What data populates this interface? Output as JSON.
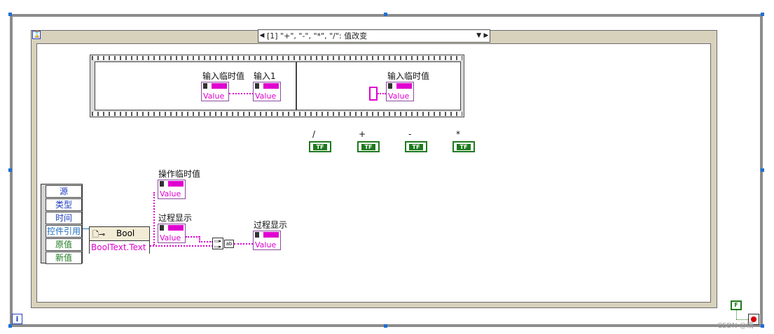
{
  "case_selector": {
    "label": "[1] \"+\", \"-\", \"*\", \"/\": 值改变"
  },
  "sequence": {
    "frame1": {
      "in_label": "输入临时值",
      "out_label": "输入1",
      "in_val": "Value",
      "out_val": "Value"
    },
    "frame2": {
      "label": "输入临时值",
      "val": "Value"
    }
  },
  "bool_labels": [
    "/",
    "+",
    "-",
    "*"
  ],
  "event_data": [
    "源",
    "类型",
    "时间",
    "控件引用",
    "原值",
    "新值"
  ],
  "ref_node": {
    "type": "Bool",
    "prop": "BoolText.Text"
  },
  "op_temp": {
    "label": "操作临时值",
    "val": "Value"
  },
  "process1": {
    "label": "过程显示",
    "val": "Value"
  },
  "process2": {
    "label": "过程显示",
    "val": "Value"
  },
  "iteration": "i",
  "stop_const": "F",
  "watermark": "CSDN @端"
}
